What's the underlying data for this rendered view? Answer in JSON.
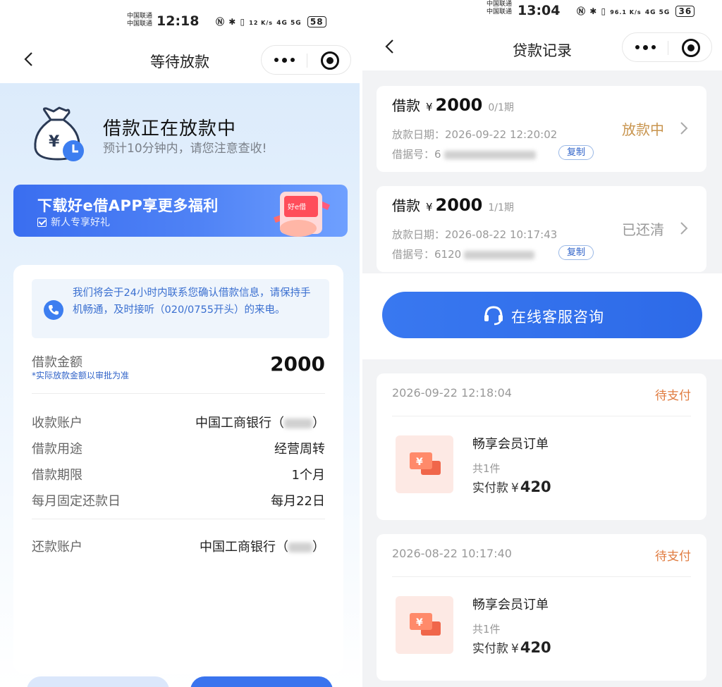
{
  "left_screen": {
    "status_bar": {
      "carrier_1": "中国联通",
      "carrier_2": "中国联通",
      "time": "12:18",
      "net_speed": "12 K/s",
      "signal": "4G 5G",
      "battery": "58"
    },
    "nav": {
      "title": "等待放款"
    },
    "status": {
      "title": "借款正在放款中",
      "subtitle": "预计10分钟内，请您注意查收!"
    },
    "banner": {
      "title": "下载好e借APP享更多福利",
      "subtitle": "新人专享好礼",
      "phone_label": "好e借"
    },
    "notice": "我们将会于24小时内联系您确认借款信息，请保持手机畅通，及时接听（020/0755开头）的来电。",
    "amount": {
      "label": "借款金额",
      "note": "*实际放款金额以审批为准",
      "value": "2000"
    },
    "details": [
      {
        "label": "收款账户",
        "value": "中国工商银行（",
        "suffix": "）"
      },
      {
        "label": "借款用途",
        "value": "经营周转"
      },
      {
        "label": "借款期限",
        "value": "1个月"
      },
      {
        "label": "每月固定还款日",
        "value": "每月22日"
      }
    ],
    "repay_account": {
      "label": "还款账户",
      "value": "中国工商银行（",
      "suffix": "）"
    }
  },
  "right_screen": {
    "status_bar": {
      "carrier_1": "中国联通",
      "carrier_2": "中国联通",
      "time": "13:04",
      "net_speed": "96.1 K/s",
      "signal": "4G 5G",
      "battery": "36"
    },
    "nav": {
      "title": "贷款记录"
    },
    "loans": [
      {
        "label": "借款",
        "currency": "¥",
        "amount": "2000",
        "period": "0/1期",
        "date": "放款日期：2026-09-22 12:20:02",
        "no_label": "借据号：",
        "no_visible": "6",
        "copy": "复制",
        "status": "放款中",
        "status_color": "#c8944e"
      },
      {
        "label": "借款",
        "currency": "¥",
        "amount": "2000",
        "period": "1/1期",
        "date": "放款日期：2026-08-22 10:17:43",
        "no_label": "借据号：",
        "no_visible": "6120",
        "copy": "复制",
        "status": "已还清",
        "status_color": "#9a9a9a"
      }
    ],
    "service_button": "在线客服咨询",
    "orders": [
      {
        "time": "2026-09-22 12:18:04",
        "status": "待支付",
        "name": "畅享会员订单",
        "qty": "共1件",
        "paid_label": "实付款",
        "currency": "¥",
        "amount": "420"
      },
      {
        "time": "2026-08-22 10:17:40",
        "status": "待支付",
        "name": "畅享会员订单",
        "qty": "共1件",
        "paid_label": "实付款",
        "currency": "¥",
        "amount": "420"
      }
    ]
  },
  "colors": {
    "primary_blue": "#3a74ee",
    "pending_orange": "#e07b3f",
    "lending_gold": "#c8944e"
  }
}
